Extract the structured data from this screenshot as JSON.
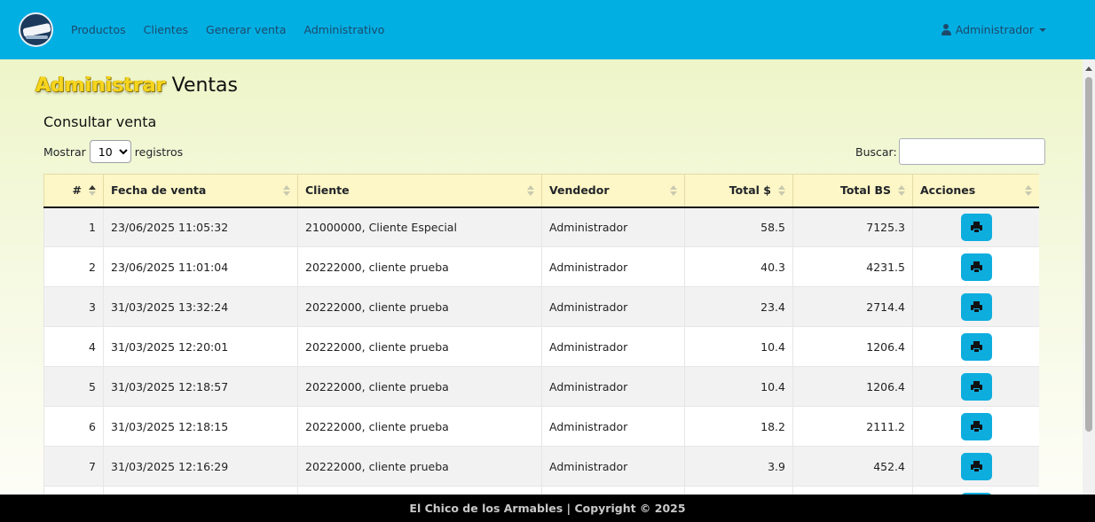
{
  "colors": {
    "navbar": "#02afe3",
    "action_button": "#0dadde",
    "title_highlight": "#f6d51f",
    "table_header": "#fdf6c6",
    "footer": "#000000"
  },
  "navbar": {
    "logo_icon": "store-logo-icon",
    "links": [
      "Productos",
      "Clientes",
      "Generar venta",
      "Administrativo"
    ],
    "user_label": "Administrador"
  },
  "page": {
    "title_highlight": "Administrar",
    "title_rest": "Ventas",
    "subtitle": "Consultar venta"
  },
  "controls": {
    "show_label": "Mostrar",
    "show_value": "10",
    "records_label": "registros",
    "search_label": "Buscar:",
    "search_value": ""
  },
  "table": {
    "headers": [
      "#",
      "Fecha de venta",
      "Cliente",
      "Vendedor",
      "Total $",
      "Total BS",
      "Acciones"
    ],
    "sorted_column": "#",
    "sort_direction": "asc",
    "action_icon": "print-icon",
    "rows": [
      {
        "id": "1",
        "fecha": "23/06/2025 11:05:32",
        "cliente": "21000000, Cliente Especial",
        "vendedor": "Administrador",
        "total_usd": "58.5",
        "total_bs": "7125.3"
      },
      {
        "id": "2",
        "fecha": "23/06/2025 11:01:04",
        "cliente": "20222000, cliente prueba",
        "vendedor": "Administrador",
        "total_usd": "40.3",
        "total_bs": "4231.5"
      },
      {
        "id": "3",
        "fecha": "31/03/2025 13:32:24",
        "cliente": "20222000, cliente prueba",
        "vendedor": "Administrador",
        "total_usd": "23.4",
        "total_bs": "2714.4"
      },
      {
        "id": "4",
        "fecha": "31/03/2025 12:20:01",
        "cliente": "20222000, cliente prueba",
        "vendedor": "Administrador",
        "total_usd": "10.4",
        "total_bs": "1206.4"
      },
      {
        "id": "5",
        "fecha": "31/03/2025 12:18:57",
        "cliente": "20222000, cliente prueba",
        "vendedor": "Administrador",
        "total_usd": "10.4",
        "total_bs": "1206.4"
      },
      {
        "id": "6",
        "fecha": "31/03/2025 12:18:15",
        "cliente": "20222000, cliente prueba",
        "vendedor": "Administrador",
        "total_usd": "18.2",
        "total_bs": "2111.2"
      },
      {
        "id": "7",
        "fecha": "31/03/2025 12:16:29",
        "cliente": "20222000, cliente prueba",
        "vendedor": "Administrador",
        "total_usd": "3.9",
        "total_bs": "452.4"
      }
    ]
  },
  "footer": {
    "text": "El Chico de los Armables | Copyright © 2025"
  }
}
